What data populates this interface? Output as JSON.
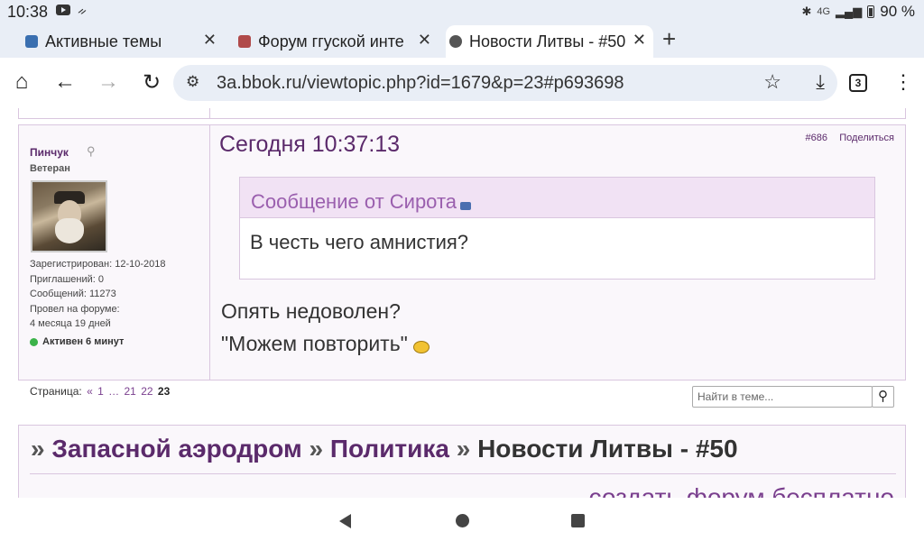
{
  "status_bar": {
    "time": "10:38",
    "network": "4G",
    "battery": "90 %"
  },
  "tabs": [
    {
      "title": "Активные темы",
      "favicon_color": "#3a6fb0"
    },
    {
      "title": "Форум ггуской инте",
      "favicon_color": "#b04a4a"
    },
    {
      "title": "Новости Литвы - #50",
      "favicon_color": "#555555"
    }
  ],
  "toolbar": {
    "url": "3a.bbok.ru/viewtopic.php?id=1679&p=23#p693698",
    "tab_count": "3"
  },
  "post": {
    "author": "Пинчук",
    "rank": "Ветеран",
    "info": [
      "Зарегистрирован: 12-10-2018",
      "Приглашений: 0",
      "Сообщений: 11273",
      "Провел на форуме:",
      "4 месяца 19 дней"
    ],
    "online_status": "Активен 6 минут",
    "date": "Сегодня 10:37:13",
    "number": "#686",
    "share": "Поделиться",
    "quote_header": "Сообщение от Сирота",
    "quote_text": "В честь чего амнистия?",
    "text_lines": [
      "Опять недоволен?",
      "\"Можем повторить\""
    ]
  },
  "pager": {
    "label": "Страница:",
    "prev": "«",
    "pages": [
      "1",
      "…",
      "21",
      "22"
    ],
    "current": "23"
  },
  "search": {
    "placeholder": "Найти в теме..."
  },
  "breadcrumbs": {
    "sep": "»",
    "items": [
      "Запасной аэродром",
      "Политика"
    ],
    "current": "Новости Литвы - #50"
  },
  "footer": {
    "link": "создать форум бесплатно"
  },
  "colors": {
    "accent": "#5b2a6b",
    "quote_header_bg": "#f1e2f4",
    "online_dot": "#3cb34a"
  }
}
